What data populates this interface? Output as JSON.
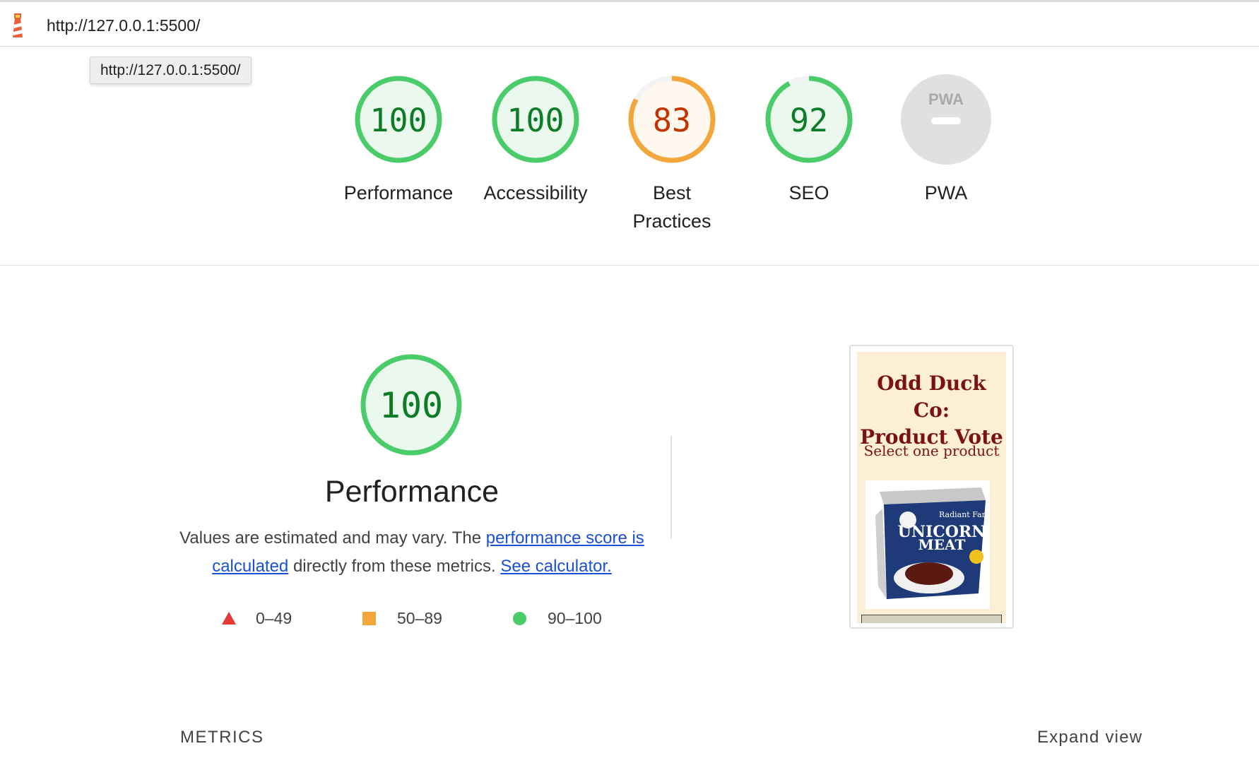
{
  "header": {
    "url": "http://127.0.0.1:5500/",
    "tooltip": "http://127.0.0.1:5500/"
  },
  "gauges": [
    {
      "label": "Performance",
      "score": "100",
      "fraction": 1.0,
      "status": "pass"
    },
    {
      "label": "Accessibility",
      "score": "100",
      "fraction": 1.0,
      "status": "pass"
    },
    {
      "label": "Best Practices",
      "label_line1": "Best",
      "label_line2": "Practices",
      "score": "83",
      "fraction": 0.83,
      "status": "average"
    },
    {
      "label": "SEO",
      "score": "92",
      "fraction": 0.92,
      "status": "pass"
    },
    {
      "label": "PWA",
      "badge": "PWA",
      "status": "na"
    }
  ],
  "performance": {
    "score": "100",
    "title": "Performance",
    "desc_prefix": "Values are estimated and may vary. The ",
    "link_score": "performance score is calculated",
    "desc_middle": " directly from these metrics. ",
    "link_calc": "See calculator."
  },
  "legend": [
    {
      "range": "0–49",
      "shape": "triangle",
      "color": "#e53935"
    },
    {
      "range": "50–89",
      "shape": "square",
      "color": "#f2a63b"
    },
    {
      "range": "90–100",
      "shape": "circle",
      "color": "#4bcc6a"
    }
  ],
  "thumbnail": {
    "title_line1": "Odd Duck Co:",
    "title_line2": "Product Vote",
    "subtitle": "Select one product",
    "can_brand": "Radiant Farms",
    "can_line1": "UNICORN",
    "can_line2": "MEAT"
  },
  "sections": {
    "metrics": "METRICS",
    "expand": "Expand view"
  },
  "colors": {
    "pass": "#0c7c26",
    "pass_ring": "#4bcc6a",
    "pass_fill": "#ebf8ee",
    "average": "#c33300",
    "average_ring": "#f2a63b",
    "average_fill": "#fff8ee",
    "na_fill": "#e0e0e0",
    "link": "#1a4fd8"
  }
}
